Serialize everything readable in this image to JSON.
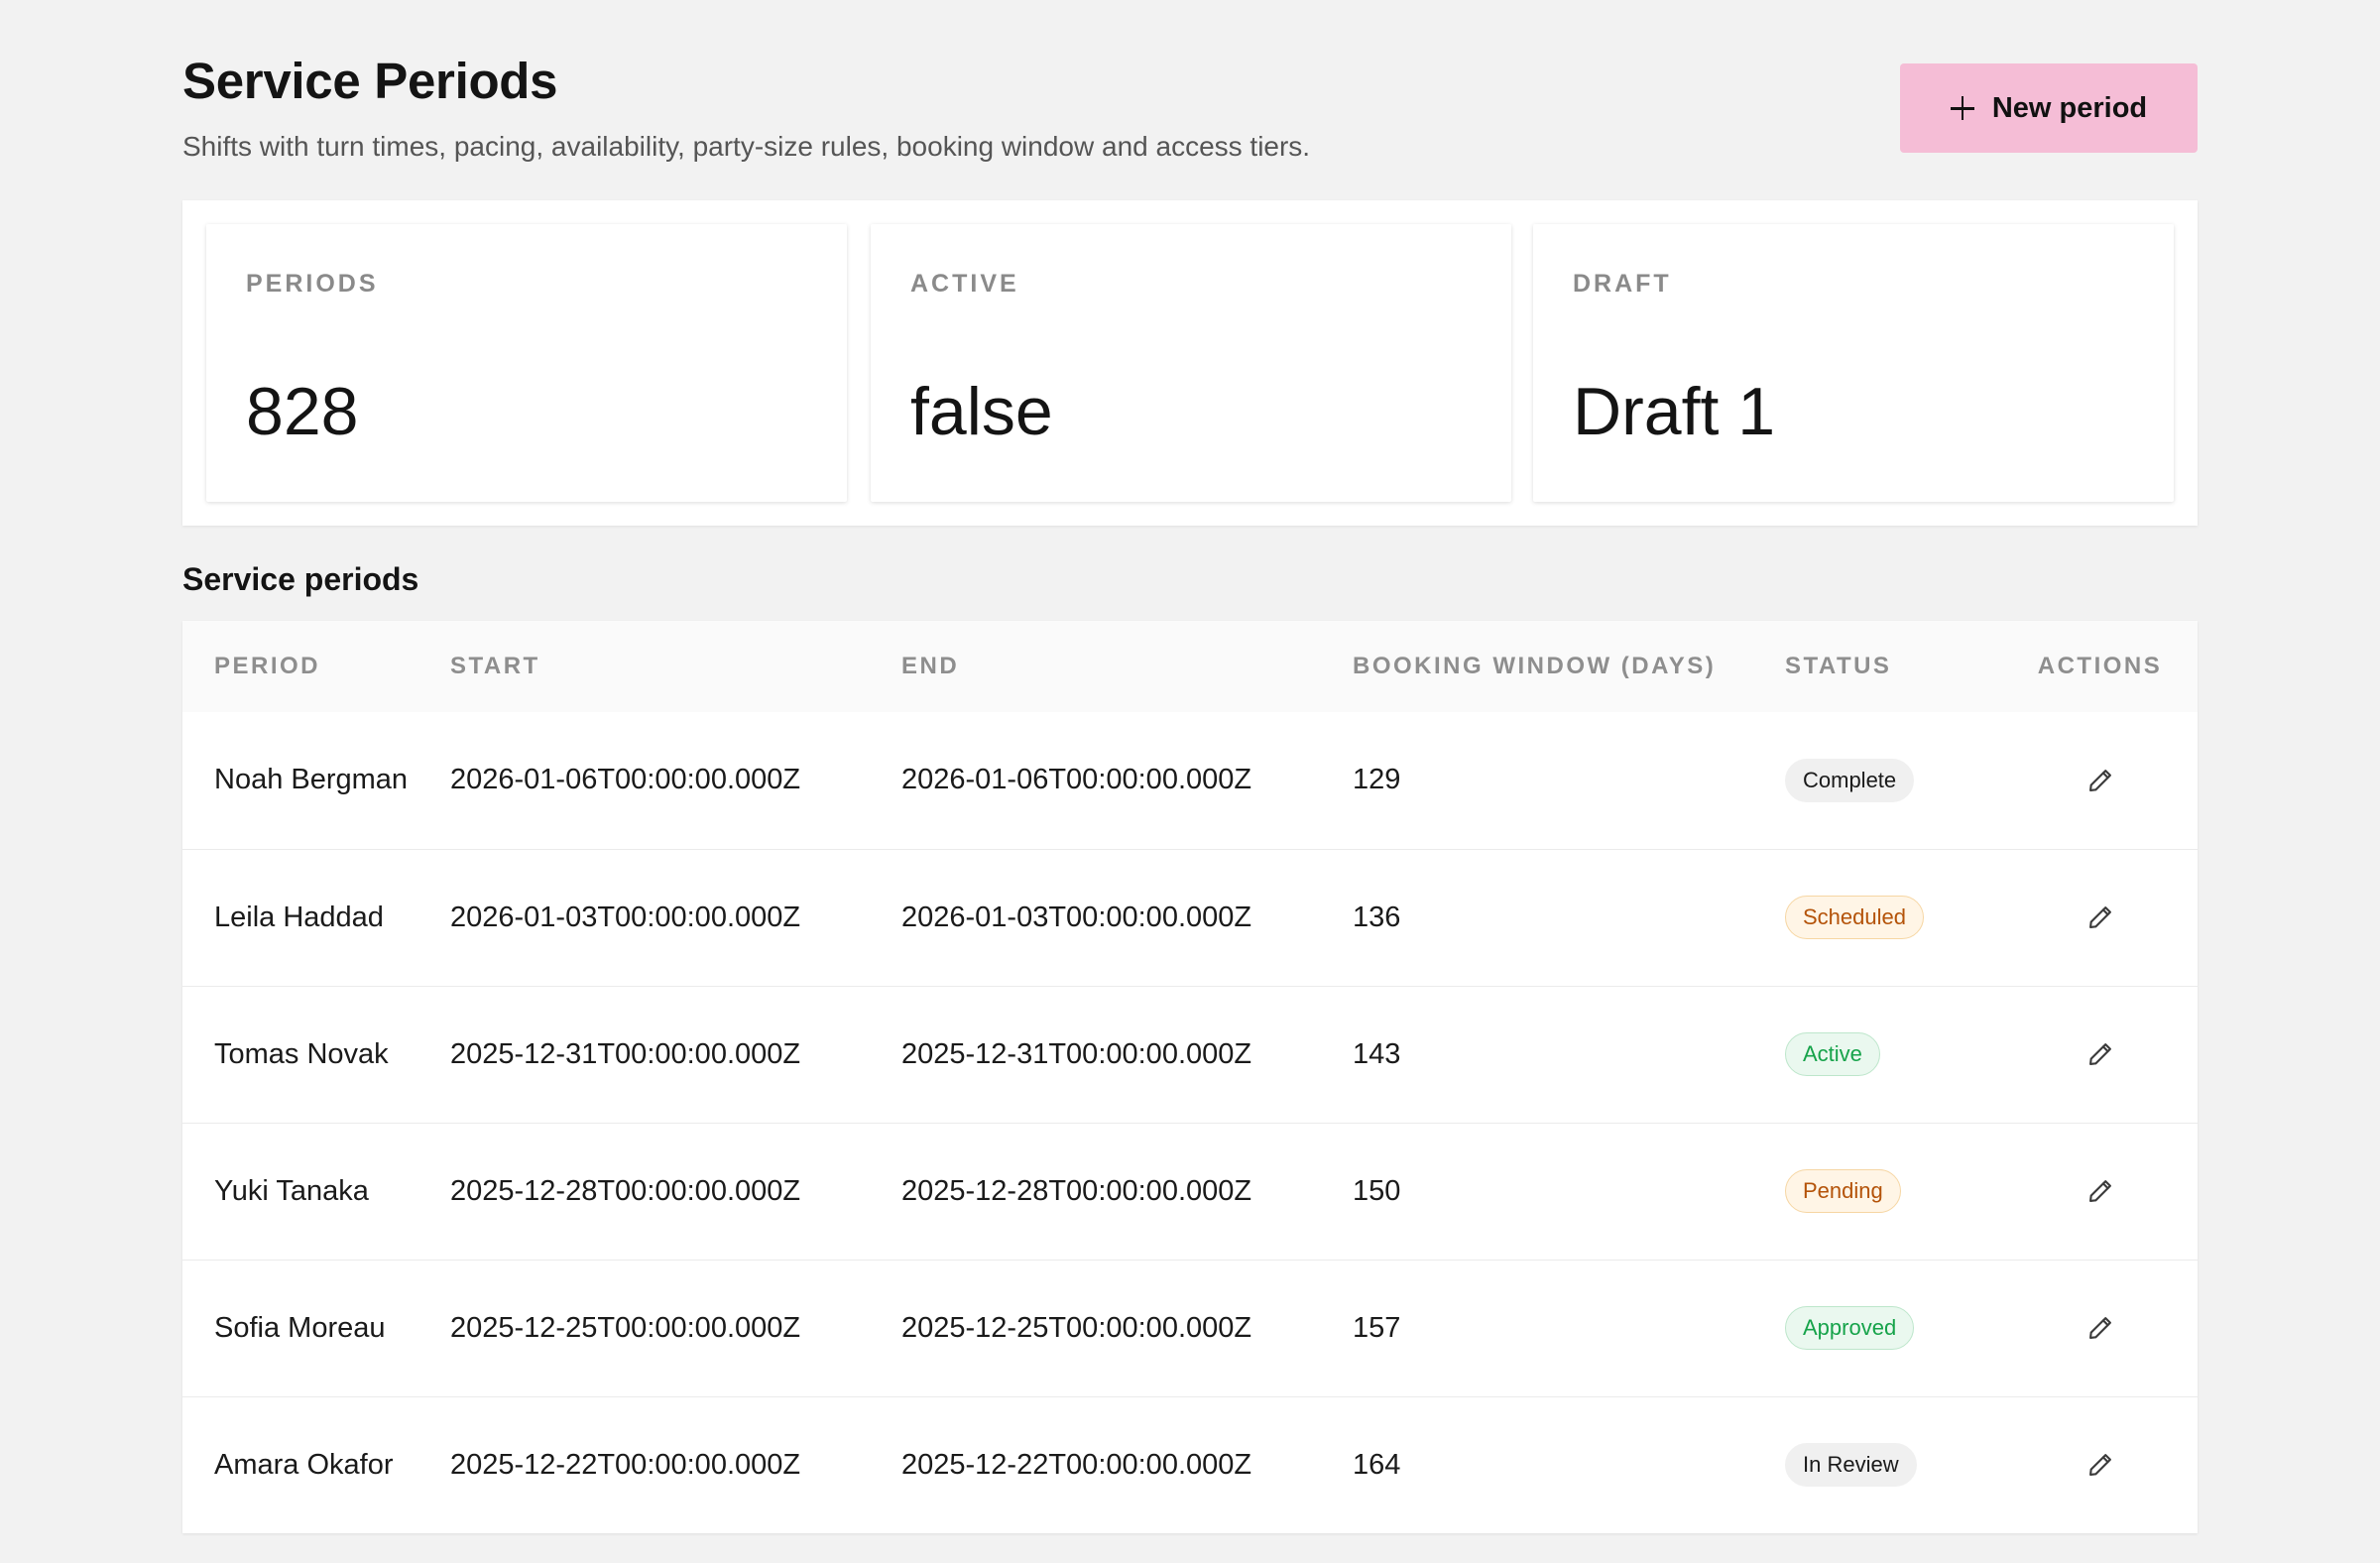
{
  "header": {
    "title": "Service Periods",
    "subtitle": "Shifts with turn times, pacing, availability, party-size rules, booking window and access tiers.",
    "new_button_label": "New period",
    "new_button_color": "#f5bdd6"
  },
  "stats": [
    {
      "label": "PERIODS",
      "value": "828"
    },
    {
      "label": "ACTIVE",
      "value": "false"
    },
    {
      "label": "DRAFT",
      "value": "Draft 1"
    }
  ],
  "table": {
    "title": "Service periods",
    "columns": [
      "PERIOD",
      "START",
      "END",
      "BOOKING WINDOW (DAYS)",
      "STATUS",
      "ACTIONS"
    ],
    "rows": [
      {
        "period": "Noah Bergman",
        "start": "2026-01-06T00:00:00.000Z",
        "end": "2026-01-06T00:00:00.000Z",
        "window": "129",
        "status": "Complete",
        "status_tone": "neutral"
      },
      {
        "period": "Leila Haddad",
        "start": "2026-01-03T00:00:00.000Z",
        "end": "2026-01-03T00:00:00.000Z",
        "window": "136",
        "status": "Scheduled",
        "status_tone": "warning"
      },
      {
        "period": "Tomas Novak",
        "start": "2025-12-31T00:00:00.000Z",
        "end": "2025-12-31T00:00:00.000Z",
        "window": "143",
        "status": "Active",
        "status_tone": "success"
      },
      {
        "period": "Yuki Tanaka",
        "start": "2025-12-28T00:00:00.000Z",
        "end": "2025-12-28T00:00:00.000Z",
        "window": "150",
        "status": "Pending",
        "status_tone": "warning"
      },
      {
        "period": "Sofia Moreau",
        "start": "2025-12-25T00:00:00.000Z",
        "end": "2025-12-25T00:00:00.000Z",
        "window": "157",
        "status": "Approved",
        "status_tone": "success"
      },
      {
        "period": "Amara Okafor",
        "start": "2025-12-22T00:00:00.000Z",
        "end": "2025-12-22T00:00:00.000Z",
        "window": "164",
        "status": "In Review",
        "status_tone": "neutral"
      }
    ],
    "row_action_icon": "pencil-icon"
  }
}
